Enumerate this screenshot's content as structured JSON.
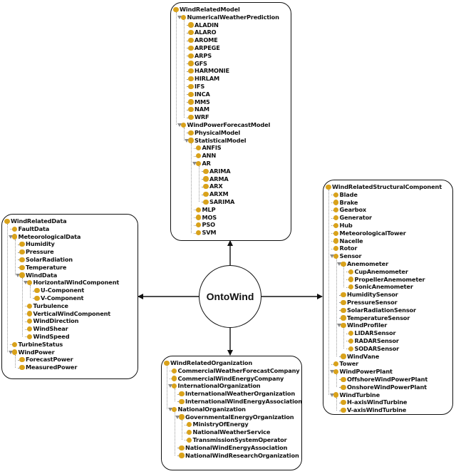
{
  "center": {
    "label": "OntoWind"
  },
  "colors": {
    "bullet": "#d9a21b",
    "line": "#111111",
    "tree_guide": "#9a9a9a"
  },
  "boxes": {
    "model": {
      "nodes": [
        {
          "label": "WindRelatedModel",
          "depth": 0
        },
        {
          "label": "NumericalWeatherPrediction",
          "depth": 1,
          "expanded": true
        },
        {
          "label": "ALADIN",
          "depth": 2
        },
        {
          "label": "ALARO",
          "depth": 2
        },
        {
          "label": "AROME",
          "depth": 2
        },
        {
          "label": "ARPEGE",
          "depth": 2
        },
        {
          "label": "ARPS",
          "depth": 2
        },
        {
          "label": "GFS",
          "depth": 2
        },
        {
          "label": "HARMONIE",
          "depth": 2
        },
        {
          "label": "HIRLAM",
          "depth": 2
        },
        {
          "label": "IFS",
          "depth": 2
        },
        {
          "label": "INCA",
          "depth": 2
        },
        {
          "label": "MM5",
          "depth": 2
        },
        {
          "label": "NAM",
          "depth": 2
        },
        {
          "label": "WRF",
          "depth": 2
        },
        {
          "label": "WindPowerForecastModel",
          "depth": 1,
          "expanded": true
        },
        {
          "label": "PhysicalModel",
          "depth": 2
        },
        {
          "label": "StatisticalModel",
          "depth": 2,
          "expanded": true
        },
        {
          "label": "ANFIS",
          "depth": 3
        },
        {
          "label": "ANN",
          "depth": 3
        },
        {
          "label": "AR",
          "depth": 3,
          "expanded": true
        },
        {
          "label": "ARIMA",
          "depth": 4
        },
        {
          "label": "ARMA",
          "depth": 4
        },
        {
          "label": "ARX",
          "depth": 4
        },
        {
          "label": "ARXM",
          "depth": 4
        },
        {
          "label": "SARIMA",
          "depth": 4
        },
        {
          "label": "MLP",
          "depth": 3
        },
        {
          "label": "MOS",
          "depth": 3
        },
        {
          "label": "PSO",
          "depth": 3
        },
        {
          "label": "SVM",
          "depth": 3
        }
      ]
    },
    "data": {
      "nodes": [
        {
          "label": "WindRelatedData",
          "depth": 0
        },
        {
          "label": "FaultData",
          "depth": 1
        },
        {
          "label": "MeteorologicalData",
          "depth": 1,
          "expanded": true
        },
        {
          "label": "Humidity",
          "depth": 2
        },
        {
          "label": "Pressure",
          "depth": 2
        },
        {
          "label": "SolarRadiation",
          "depth": 2
        },
        {
          "label": "Temperature",
          "depth": 2
        },
        {
          "label": "WindData",
          "depth": 2,
          "expanded": true
        },
        {
          "label": "HorizontalWindComponent",
          "depth": 3,
          "expanded": true
        },
        {
          "label": "U-Component",
          "depth": 4
        },
        {
          "label": "V-Component",
          "depth": 4
        },
        {
          "label": "Turbulence",
          "depth": 3
        },
        {
          "label": "VerticalWindComponent",
          "depth": 3
        },
        {
          "label": "WindDirection",
          "depth": 3
        },
        {
          "label": "WindShear",
          "depth": 3
        },
        {
          "label": "WindSpeed",
          "depth": 3
        },
        {
          "label": "TurbineStatus",
          "depth": 1
        },
        {
          "label": "WindPower",
          "depth": 1,
          "expanded": true
        },
        {
          "label": "ForecastPower",
          "depth": 2
        },
        {
          "label": "MeasuredPower",
          "depth": 2
        }
      ]
    },
    "structural": {
      "nodes": [
        {
          "label": "WindRelatedStructuralComponent",
          "depth": 0
        },
        {
          "label": "Blade",
          "depth": 1
        },
        {
          "label": "Brake",
          "depth": 1
        },
        {
          "label": "Gearbox",
          "depth": 1
        },
        {
          "label": "Generator",
          "depth": 1
        },
        {
          "label": "Hub",
          "depth": 1
        },
        {
          "label": "MeteorologicalTower",
          "depth": 1
        },
        {
          "label": "Nacelle",
          "depth": 1
        },
        {
          "label": "Rotor",
          "depth": 1
        },
        {
          "label": "Sensor",
          "depth": 1,
          "expanded": true
        },
        {
          "label": "Anemometer",
          "depth": 2,
          "expanded": true
        },
        {
          "label": "CupAnemometer",
          "depth": 3
        },
        {
          "label": "PropellerAnemometer",
          "depth": 3
        },
        {
          "label": "SonicAnemometer",
          "depth": 3
        },
        {
          "label": "HumiditySensor",
          "depth": 2
        },
        {
          "label": "PressureSensor",
          "depth": 2
        },
        {
          "label": "SolarRadiationSensor",
          "depth": 2
        },
        {
          "label": "TemperatureSensor",
          "depth": 2
        },
        {
          "label": "WindProfiler",
          "depth": 2,
          "expanded": true
        },
        {
          "label": "LIDARSensor",
          "depth": 3
        },
        {
          "label": "RADARSensor",
          "depth": 3
        },
        {
          "label": "SODARSensor",
          "depth": 3
        },
        {
          "label": "WindVane",
          "depth": 2
        },
        {
          "label": "Tower",
          "depth": 1
        },
        {
          "label": "WindPowerPlant",
          "depth": 1,
          "expanded": true
        },
        {
          "label": "OffshoreWindPowerPlant",
          "depth": 2
        },
        {
          "label": "OnshoreWindPowerPlant",
          "depth": 2
        },
        {
          "label": "WindTurbine",
          "depth": 1,
          "expanded": true
        },
        {
          "label": "H-axisWindTurbine",
          "depth": 2
        },
        {
          "label": "V-axisWindTurbine",
          "depth": 2
        }
      ]
    },
    "organization": {
      "nodes": [
        {
          "label": "WindRelatedOrganization",
          "depth": 0
        },
        {
          "label": "CommercialWeatherForecastCompany",
          "depth": 1
        },
        {
          "label": "CommercialWindEnergyCompany",
          "depth": 1
        },
        {
          "label": "InternationalOrganization",
          "depth": 1,
          "expanded": true
        },
        {
          "label": "InternationalWeatherOrganization",
          "depth": 2
        },
        {
          "label": "InternationalWindEnergyAssociation",
          "depth": 2
        },
        {
          "label": "NationalOrganization",
          "depth": 1,
          "expanded": true
        },
        {
          "label": "GovernmentalEnergyOrganization",
          "depth": 2,
          "expanded": true
        },
        {
          "label": "MinistryOfEnergy",
          "depth": 3
        },
        {
          "label": "NationalWeatherService",
          "depth": 3
        },
        {
          "label": "TransmissionSystemOperator",
          "depth": 3
        },
        {
          "label": "NationalWindEnergyAssociation",
          "depth": 2
        },
        {
          "label": "NationalWindResearchOrganization",
          "depth": 2
        }
      ]
    }
  }
}
